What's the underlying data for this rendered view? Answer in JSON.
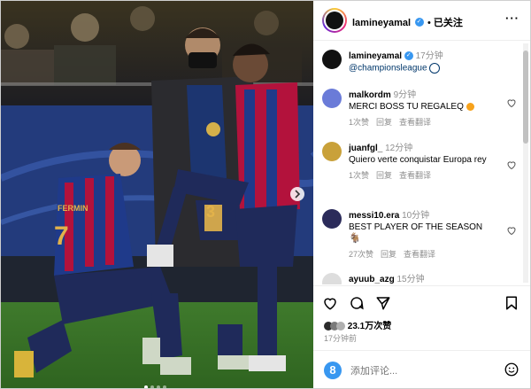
{
  "header": {
    "username": "lamineyamal",
    "follow_status": "已关注",
    "more_label": "···"
  },
  "caption": {
    "username": "lamineyamal",
    "time": "17分钟",
    "mention": "@championsleague"
  },
  "comments": [
    {
      "username": "malkordm",
      "time": "9分钟",
      "text": "MERCI BOSS TU REGALEQ",
      "likes": "1次赞",
      "reply": "回复",
      "translate": "查看翻译",
      "avatar_color": "#6a7bd8"
    },
    {
      "username": "juanfgl_",
      "time": "12分钟",
      "text": "Quiero verte conquistar Europa rey",
      "likes": "1次赞",
      "reply": "回复",
      "translate": "查看翻译",
      "avatar_color": "#c9a13a"
    },
    {
      "username": "messi10.era",
      "time": "10分钟",
      "text": "BEST PLAYER OF THE SEASON",
      "likes": "27次赞",
      "reply": "回复",
      "translate": "查看翻译",
      "avatar_color": "#2b2b5a"
    },
    {
      "username": "ayuub_azg",
      "time": "15分钟",
      "text": "",
      "likes": "",
      "reply": "",
      "translate": "",
      "avatar_color": "#ddd"
    }
  ],
  "stats": {
    "likes": "23.1万次赞",
    "posted_ago": "17分钟前"
  },
  "add_comment": {
    "placeholder": "添加评论..."
  },
  "photo": {
    "jersey_name": "FERMIN",
    "jersey_number_left": "7",
    "jersey_number_mid": "3"
  },
  "colors": {
    "accent": "#3897f0",
    "barca_blue": "#1f3a8a",
    "barca_red": "#b3123c"
  }
}
